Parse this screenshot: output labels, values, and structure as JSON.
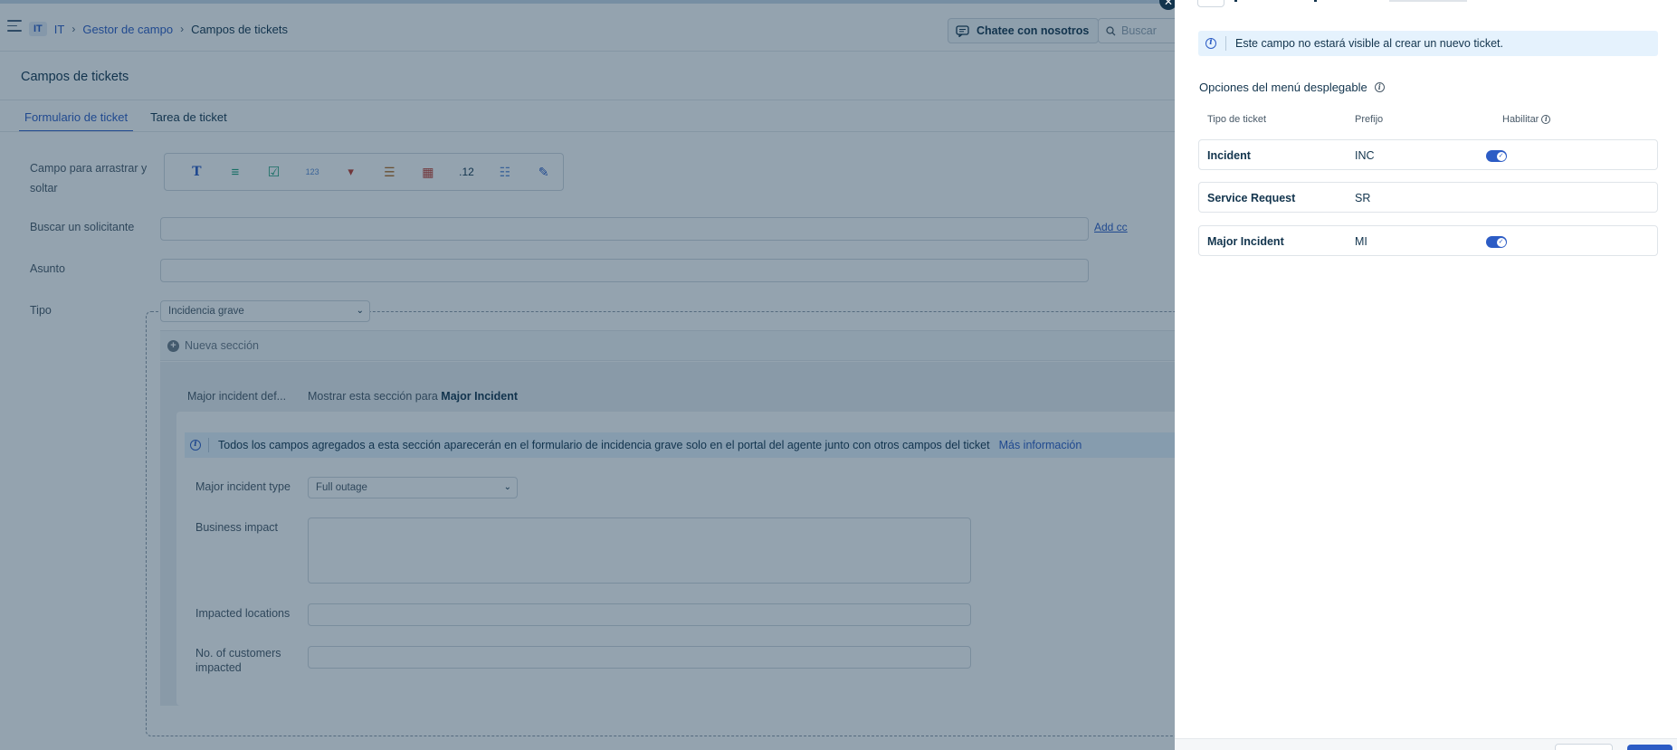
{
  "header": {
    "workspace_badge": "IT",
    "workspace_name": "IT",
    "breadcrumb_parent": "Gestor de campo",
    "breadcrumb_current": "Campos de tickets",
    "chat_button": "Chatee con nosotros",
    "search_placeholder": "Buscar"
  },
  "page": {
    "title": "Campos de tickets",
    "tabs": [
      {
        "label": "Formulario de ticket",
        "active": true
      },
      {
        "label": "Tarea de ticket",
        "active": false
      }
    ]
  },
  "form": {
    "drag_label": "Campo para arrastrar y soltar",
    "toolbox": [
      {
        "icon": "text-field-icon",
        "glyph": "T"
      },
      {
        "icon": "paragraph-icon",
        "glyph": "≡"
      },
      {
        "icon": "checkbox-icon",
        "glyph": "☑"
      },
      {
        "icon": "number-icon",
        "glyph": "123"
      },
      {
        "icon": "dropdown-icon",
        "glyph": "▾"
      },
      {
        "icon": "multiline-icon",
        "glyph": "☰"
      },
      {
        "icon": "date-icon",
        "glyph": "▦"
      },
      {
        "icon": "decimal-icon",
        "glyph": ".12"
      },
      {
        "icon": "list-icon",
        "glyph": "☷"
      },
      {
        "icon": "edit-icon",
        "glyph": "✎"
      }
    ],
    "requester_label": "Buscar un solicitante",
    "add_cc": "Add cc",
    "subject_label": "Asunto",
    "type_label": "Tipo",
    "type_value": "Incidencia grave",
    "new_section": "Nueva sección",
    "section_name": "Major incident def...",
    "section_show_prefix": "Mostrar esta sección para",
    "section_show_for": "Major Incident",
    "section_info": "Todos los campos agregados a esta sección aparecerán en el formulario de incidencia grave solo en el portal del agente junto con otros campos del ticket",
    "section_info_link": "Más información",
    "major_type_label": "Major incident type",
    "major_type_value": "Full outage",
    "business_impact_label": "Business impact",
    "impacted_locations_label": "Impacted locations",
    "customers_impacted_label_1": "No. of customers",
    "customers_impacted_label_2": "impacted"
  },
  "panel": {
    "info_text": "Este campo no estará visible al crear un nuevo ticket.",
    "options_title": "Opciones del menú desplegable",
    "col_type": "Tipo de ticket",
    "col_prefix": "Prefijo",
    "col_enable": "Habilitar",
    "rows": [
      {
        "type": "Incident",
        "prefix": "INC",
        "enabled": true
      },
      {
        "type": "Service Request",
        "prefix": "SR",
        "enabled": false
      },
      {
        "type": "Major Incident",
        "prefix": "MI",
        "enabled": true
      }
    ]
  },
  "colors": {
    "accent": "#2c5cc5",
    "overlay": "#12344d",
    "info_bg": "#e5f2fd"
  }
}
